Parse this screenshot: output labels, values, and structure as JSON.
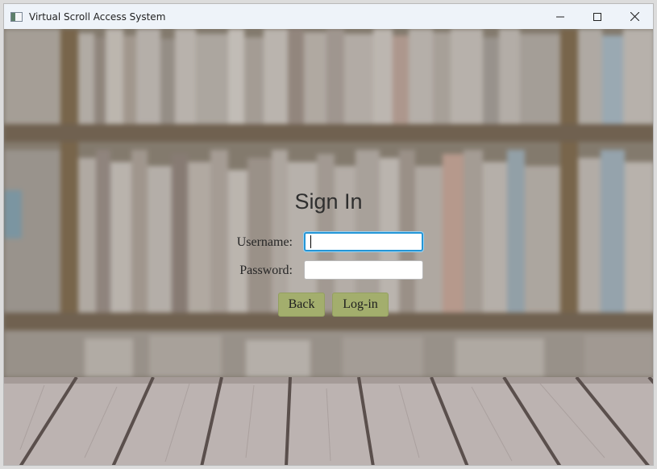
{
  "window": {
    "title": "Virtual Scroll Access System",
    "icon": "app-window-icon",
    "controls": {
      "minimize": "minimize-icon",
      "maximize": "maximize-icon",
      "close": "close-icon"
    }
  },
  "signin": {
    "heading": "Sign In",
    "username_label": "Username:",
    "username_value": "",
    "password_label": "Password:",
    "password_value": "",
    "back_label": "Back",
    "login_label": "Log-in"
  },
  "colors": {
    "button_bg": "#a3ae6d",
    "focus_border": "#2596d6",
    "titlebar_bg": "#eef3f9"
  }
}
